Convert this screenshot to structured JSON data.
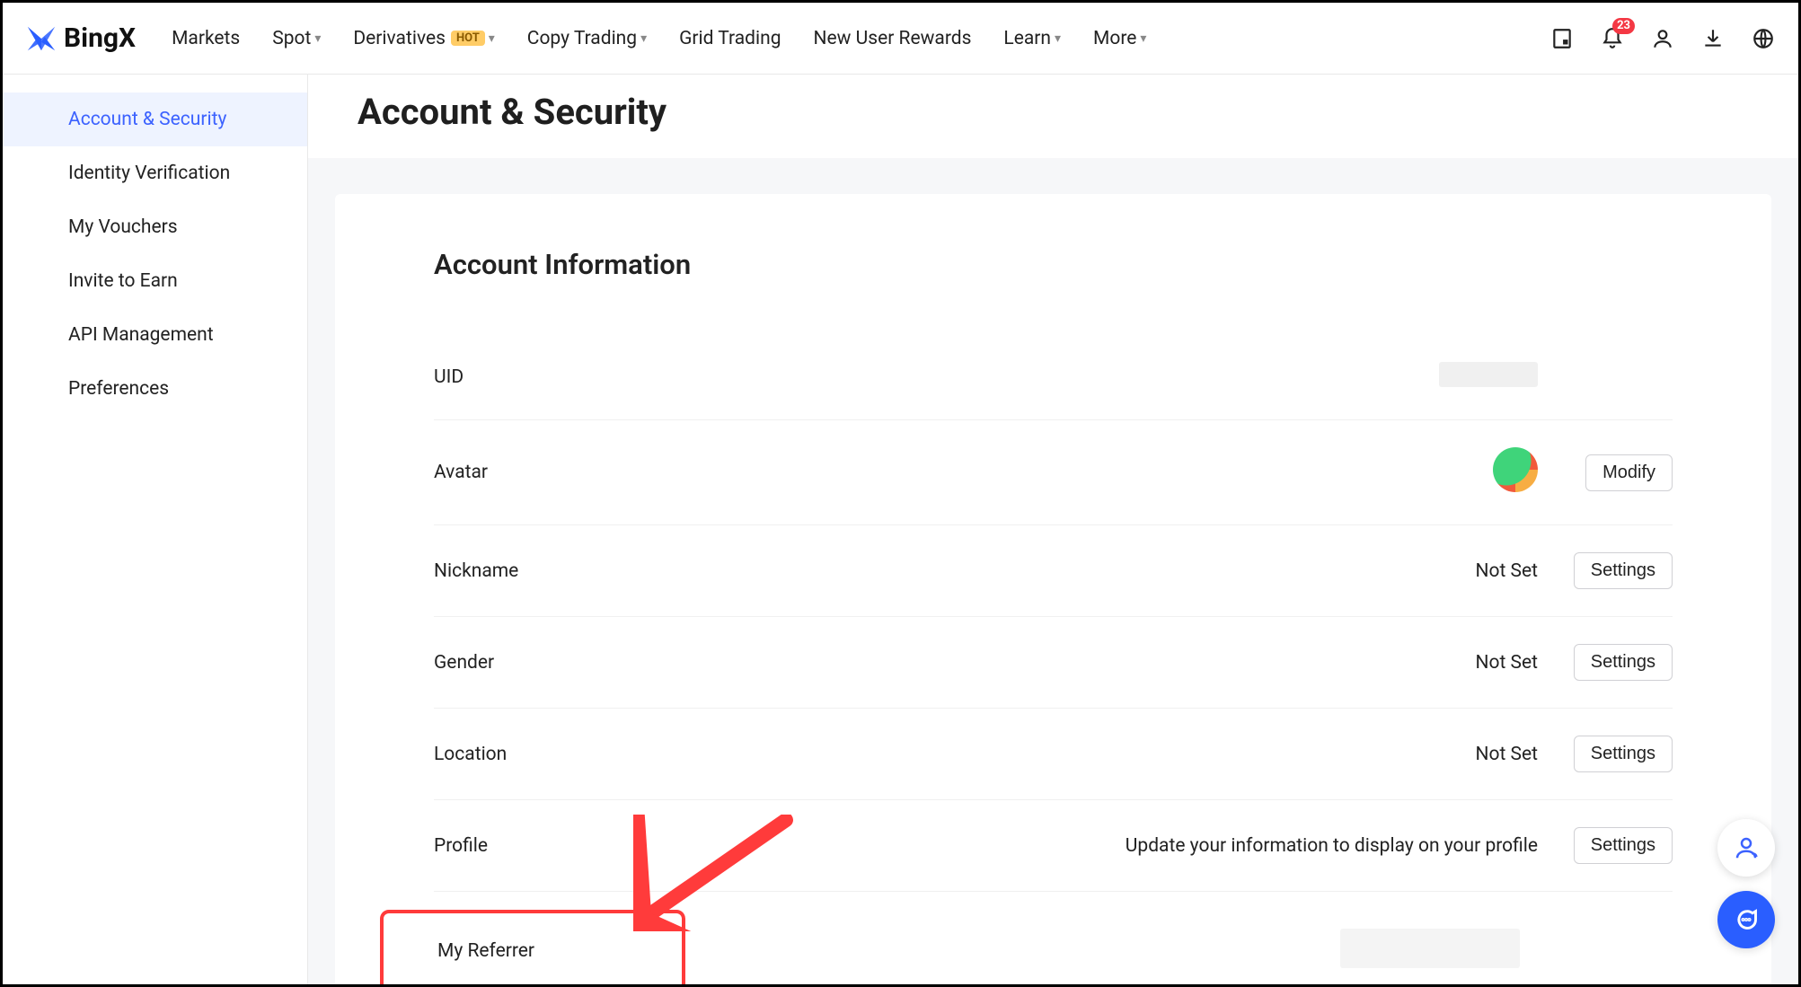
{
  "brand": {
    "name": "BingX"
  },
  "nav": {
    "markets": "Markets",
    "spot": "Spot",
    "derivatives": "Derivatives",
    "derivatives_badge": "HOT",
    "copy_trading": "Copy Trading",
    "grid_trading": "Grid Trading",
    "new_user_rewards": "New User Rewards",
    "learn": "Learn",
    "more": "More"
  },
  "topicons": {
    "notif_count": "23"
  },
  "sidebar": {
    "items": [
      {
        "label": "Account & Security"
      },
      {
        "label": "Identity Verification"
      },
      {
        "label": "My Vouchers"
      },
      {
        "label": "Invite to Earn"
      },
      {
        "label": "API Management"
      },
      {
        "label": "Preferences"
      }
    ]
  },
  "page": {
    "title": "Account & Security",
    "section_heading": "Account Information",
    "rows": {
      "uid": {
        "label": "UID"
      },
      "avatar": {
        "label": "Avatar",
        "action": "Modify"
      },
      "nickname": {
        "label": "Nickname",
        "value": "Not Set",
        "action": "Settings"
      },
      "gender": {
        "label": "Gender",
        "value": "Not Set",
        "action": "Settings"
      },
      "location": {
        "label": "Location",
        "value": "Not Set",
        "action": "Settings"
      },
      "profile": {
        "label": "Profile",
        "value": "Update your information to display on your profile",
        "action": "Settings"
      },
      "my_referrer": {
        "label": "My Referrer"
      }
    }
  }
}
